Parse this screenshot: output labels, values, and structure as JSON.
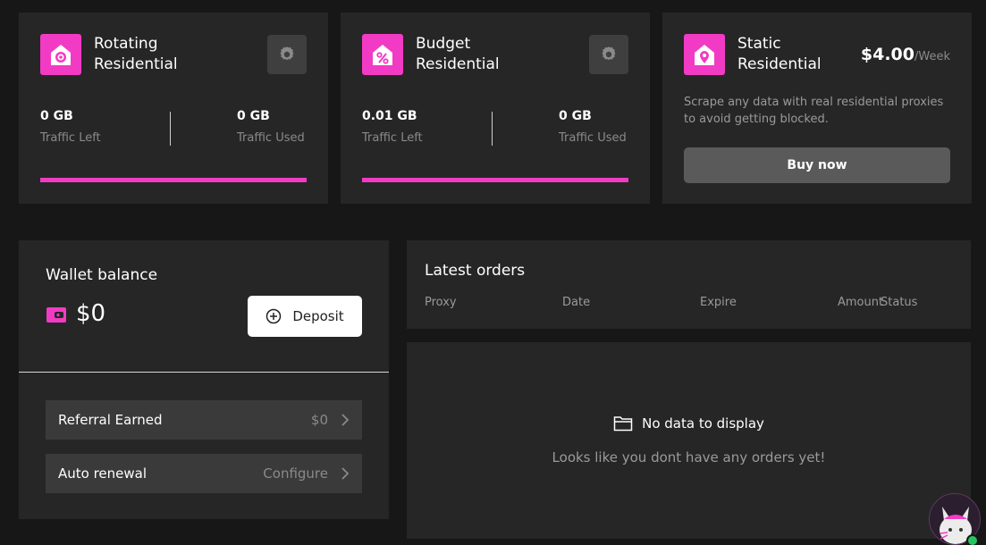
{
  "products": {
    "rotating": {
      "title": "Rotating\nResidential",
      "icon": "house-target-icon",
      "traffic_left": "0 GB",
      "traffic_left_label": "Traffic Left",
      "traffic_used": "0 GB",
      "traffic_used_label": "Traffic Used",
      "progress": 1.0
    },
    "budget": {
      "title": "Budget\nResidential",
      "icon": "house-percent-icon",
      "traffic_left": "0.01 GB",
      "traffic_left_label": "Traffic Left",
      "traffic_used": "0 GB",
      "traffic_used_label": "Traffic Used",
      "progress": 1.0
    },
    "static": {
      "title": "Static\nResidential",
      "icon": "house-pin-icon",
      "price": "$4.00",
      "price_unit": "/Week",
      "description": "Scrape any data with real residential proxies to avoid getting blocked.",
      "buy_label": "Buy now"
    }
  },
  "wallet": {
    "title": "Wallet balance",
    "balance": "$0",
    "deposit_label": "Deposit",
    "referral_label": "Referral Earned",
    "referral_value": "$0",
    "renewal_label": "Auto renewal",
    "renewal_value": "Configure"
  },
  "orders": {
    "title": "Latest orders",
    "columns": [
      "Proxy",
      "Date",
      "Expire",
      "Amount",
      "Status"
    ],
    "empty_title": "No data to display",
    "empty_subtitle": "Looks like you dont have any orders yet!"
  },
  "colors": {
    "accent": "#f23bc4",
    "background": "#171717",
    "card": "#262626",
    "online": "#22c55e"
  }
}
